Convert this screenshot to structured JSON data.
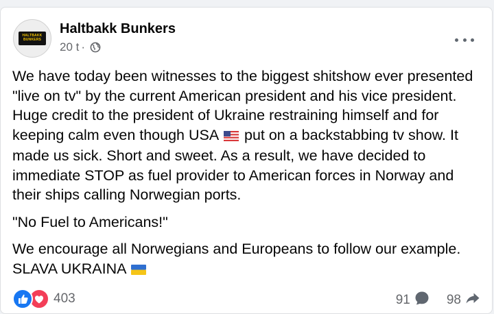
{
  "post": {
    "author": "Haltbakk Bunkers",
    "avatar_text_line1": "HALTBAKK",
    "avatar_text_line2": "BUNKERS",
    "time": "20 t",
    "separator": "·",
    "privacy_icon": "globe-icon",
    "menu_icon": "more-options-icon",
    "paragraphs": {
      "p1_before_flag": "We have today been witnesses to the biggest shitshow ever presented \"live on tv\" by the current American president and his vice president. Huge credit to the president of Ukraine restraining himself and for keeping calm even though USA",
      "p1_after_flag": "put on a backstabbing tv show. It made us sick. Short and sweet. As a result, we have decided to immediate STOP as fuel provider to American forces in Norway and their ships calling Norwegian ports.",
      "p2": "\"No Fuel to Americans!\"",
      "p3": "We encourage all Norwegians and Europeans to follow our example.",
      "p4": "SLAVA UKRAINA"
    },
    "flag_icons": [
      "us-flag-icon",
      "ukraine-flag-icon"
    ]
  },
  "engagement": {
    "reactions_count": "403",
    "reaction_icons": [
      "like-icon",
      "love-icon"
    ],
    "comments_count": "91",
    "shares_count": "98",
    "colors": {
      "like": "#1877f2",
      "love": "#f33e58",
      "secondary_text": "#65676b"
    }
  }
}
